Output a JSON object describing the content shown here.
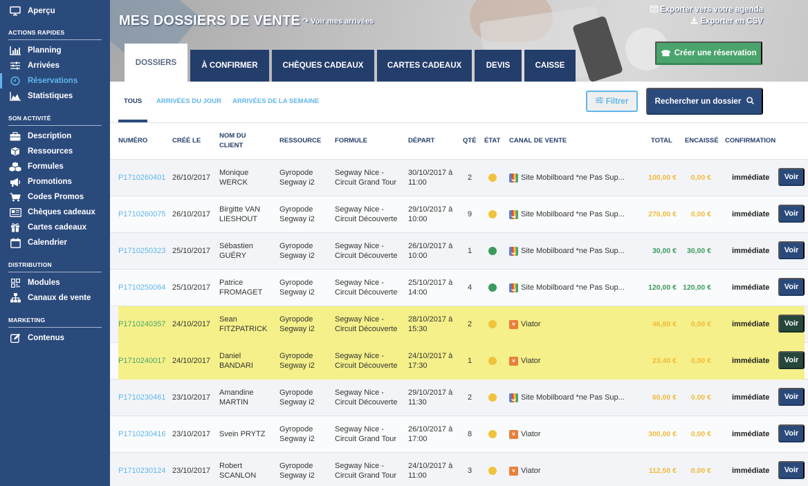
{
  "sidebar": {
    "apercu": "Aperçu",
    "sections": [
      {
        "title": "ACTIONS RAPIDES",
        "items": [
          {
            "label": "Planning",
            "icon": "bar-chart-icon"
          },
          {
            "label": "Arrivées",
            "icon": "sliders-icon"
          },
          {
            "label": "Réservations",
            "icon": "clock-icon",
            "active": true
          },
          {
            "label": "Statistiques",
            "icon": "area-chart-icon"
          }
        ]
      },
      {
        "title": "SON ACTIVITÉ",
        "items": [
          {
            "label": "Description",
            "icon": "briefcase-icon"
          },
          {
            "label": "Ressources",
            "icon": "cube-icon"
          },
          {
            "label": "Formules",
            "icon": "cubes-icon"
          },
          {
            "label": "Promotions",
            "icon": "megaphone-icon"
          },
          {
            "label": "Codes Promos",
            "icon": "cart-icon"
          },
          {
            "label": "Chèques cadeaux",
            "icon": "newspaper-icon"
          },
          {
            "label": "Cartes cadeaux",
            "icon": "gift-icon"
          },
          {
            "label": "Calendrier",
            "icon": "calendar-icon"
          }
        ]
      },
      {
        "title": "DISTRIBUTION",
        "items": [
          {
            "label": "Modules",
            "icon": "qrcode-icon"
          },
          {
            "label": "Canaux de vente",
            "icon": "sitemap-icon"
          }
        ]
      },
      {
        "title": "MARKETING",
        "items": [
          {
            "label": "Contenus",
            "icon": "edit-icon"
          }
        ]
      }
    ]
  },
  "header": {
    "title": "MES DOSSIERS DE VENTE",
    "voir_arrivees": "Voir mes arrivées",
    "export_agenda": "Exporter vers votre agenda",
    "export_csv": "Exporter en CSV",
    "create_button": "Créer une réservation",
    "tabs": [
      "DOSSIERS",
      "À CONFIRMER",
      "CHÈQUES CADEAUX",
      "CARTES CADEAUX",
      "DEVIS",
      "CAISSE"
    ],
    "active_tab": 0
  },
  "subnav": {
    "tabs": [
      "TOUS",
      "ARRIVÉES DU JOUR",
      "ARRIVÉES DE LA SEMAINE"
    ],
    "active_tab": 0,
    "filter_button": "Filtrer",
    "search_button": "Rechercher un dossier"
  },
  "table": {
    "columns": [
      "NUMÉRO",
      "CRÉÉ LE",
      "NOM DU CLIENT",
      "RESSOURCE",
      "FORMULE",
      "DÉPART",
      "QTÉ",
      "ÉTAT",
      "CANAL DE VENTE",
      "TOTAL",
      "ENCAISSÉ",
      "CONFIRMATION"
    ],
    "column_lines": {
      "client": [
        "NOM DU",
        "CLIENT"
      ]
    },
    "action_label": "Voir",
    "status_colors": {
      "pending": "#f0c33c",
      "paid": "#3c9a5f"
    },
    "rows": [
      {
        "numero": "P1710260401",
        "cree": "26/10/2017",
        "client": [
          "Monique",
          "WERCK"
        ],
        "ressource": [
          "Gyropode",
          "Segway i2"
        ],
        "formule": [
          "Segway Nice -",
          "Circuit Grand Tour"
        ],
        "depart": [
          "30/10/2017 à",
          "11:00"
        ],
        "qte": "2",
        "etat": "pending",
        "canal": "Site Mobilboard *ne Pas Sup...",
        "canal_icon": "mobilboard",
        "total": "100,00 €",
        "encaisse": "0,00 €",
        "confirmation": "immédiate",
        "highlight": false
      },
      {
        "numero": "P1710260075",
        "cree": "26/10/2017",
        "client": [
          "Birgitte VAN",
          "LIESHOUT"
        ],
        "ressource": [
          "Gyropode",
          "Segway i2"
        ],
        "formule": [
          "Segway Nice -",
          "Circuit Découverte"
        ],
        "depart": [
          "29/10/2017 à",
          "10:00"
        ],
        "qte": "9",
        "etat": "pending",
        "canal": "Site Mobilboard *ne Pas Sup...",
        "canal_icon": "mobilboard",
        "total": "270,00 €",
        "encaisse": "0,00 €",
        "confirmation": "immédiate",
        "highlight": false
      },
      {
        "numero": "P1710250323",
        "cree": "25/10/2017",
        "client": [
          "Sébastien",
          "GUÉRY"
        ],
        "ressource": [
          "Gyropode",
          "Segway i2"
        ],
        "formule": [
          "Segway Nice -",
          "Circuit Découverte"
        ],
        "depart": [
          "26/10/2017 à",
          "10:00"
        ],
        "qte": "1",
        "etat": "paid",
        "canal": "Site Mobilboard *ne Pas Sup...",
        "canal_icon": "mobilboard",
        "total": "30,00 €",
        "encaisse": "30,00 €",
        "confirmation": "immédiate",
        "highlight": false
      },
      {
        "numero": "P1710250064",
        "cree": "25/10/2017",
        "client": [
          "Patrice",
          "FROMAGET"
        ],
        "ressource": [
          "Gyropode",
          "Segway i2"
        ],
        "formule": [
          "Segway Nice -",
          "Circuit Découverte"
        ],
        "depart": [
          "25/10/2017 à",
          "14:00"
        ],
        "qte": "4",
        "etat": "paid",
        "canal": "Site Mobilboard *ne Pas Sup...",
        "canal_icon": "mobilboard",
        "total": "120,00 €",
        "encaisse": "120,00 €",
        "confirmation": "immédiate",
        "highlight": false
      },
      {
        "numero": "P1710240357",
        "cree": "24/10/2017",
        "client": [
          "Sean",
          "FITZPATRICK"
        ],
        "ressource": [
          "Gyropode",
          "Segway i2"
        ],
        "formule": [
          "Segway Nice -",
          "Circuit Découverte"
        ],
        "depart": [
          "28/10/2017 à",
          "15:30"
        ],
        "qte": "2",
        "etat": "pending",
        "canal": "Viator",
        "canal_icon": "viator",
        "total": "46,80 €",
        "encaisse": "0,00 €",
        "confirmation": "immédiate",
        "highlight": true
      },
      {
        "numero": "P1710240017",
        "cree": "24/10/2017",
        "client": [
          "Daniel",
          "BANDARI"
        ],
        "ressource": [
          "Gyropode",
          "Segway i2"
        ],
        "formule": [
          "Segway Nice -",
          "Circuit Découverte"
        ],
        "depart": [
          "24/10/2017 à",
          "17:30"
        ],
        "qte": "1",
        "etat": "pending",
        "canal": "Viator",
        "canal_icon": "viator",
        "total": "23,40 €",
        "encaisse": "0,00 €",
        "confirmation": "immédiate",
        "highlight": true
      },
      {
        "numero": "P1710230461",
        "cree": "23/10/2017",
        "client": [
          "Amandine",
          "MARTIN"
        ],
        "ressource": [
          "Gyropode",
          "Segway i2"
        ],
        "formule": [
          "Segway Nice -",
          "Circuit Découverte"
        ],
        "depart": [
          "29/10/2017 à",
          "11:30"
        ],
        "qte": "2",
        "etat": "pending",
        "canal": "Site Mobilboard *ne Pas Sup...",
        "canal_icon": "mobilboard",
        "total": "60,00 €",
        "encaisse": "0,00 €",
        "confirmation": "immédiate",
        "highlight": false
      },
      {
        "numero": "P1710230416",
        "cree": "23/10/2017",
        "client": [
          "Svein PRYTZ"
        ],
        "ressource": [
          "Gyropode",
          "Segway i2"
        ],
        "formule": [
          "Segway Nice -",
          "Circuit Grand Tour"
        ],
        "depart": [
          "26/10/2017 à",
          "17:00"
        ],
        "qte": "8",
        "etat": "pending",
        "canal": "Viator",
        "canal_icon": "viator",
        "total": "300,00 €",
        "encaisse": "0,00 €",
        "confirmation": "immédiate",
        "highlight": false
      },
      {
        "numero": "P1710230124",
        "cree": "23/10/2017",
        "client": [
          "Robert",
          "SCANLON"
        ],
        "ressource": [
          "Gyropode",
          "Segway i2"
        ],
        "formule": [
          "Segway Nice -",
          "Circuit Grand Tour"
        ],
        "depart": [
          "24/10/2017 à",
          "11:00"
        ],
        "qte": "3",
        "etat": "pending",
        "canal": "Viator",
        "canal_icon": "viator",
        "total": "112,50 €",
        "encaisse": "0,00 €",
        "confirmation": "immédiate",
        "highlight": false
      }
    ]
  },
  "colors": {
    "sidebar_bg": "#2b4a7c",
    "accent_blue": "#5fb6ec",
    "create_green": "#4aa46b",
    "highlight_yellow": "#f5f089",
    "amount_orange": "#f0bb3a",
    "amount_green": "#3c9a5f"
  }
}
